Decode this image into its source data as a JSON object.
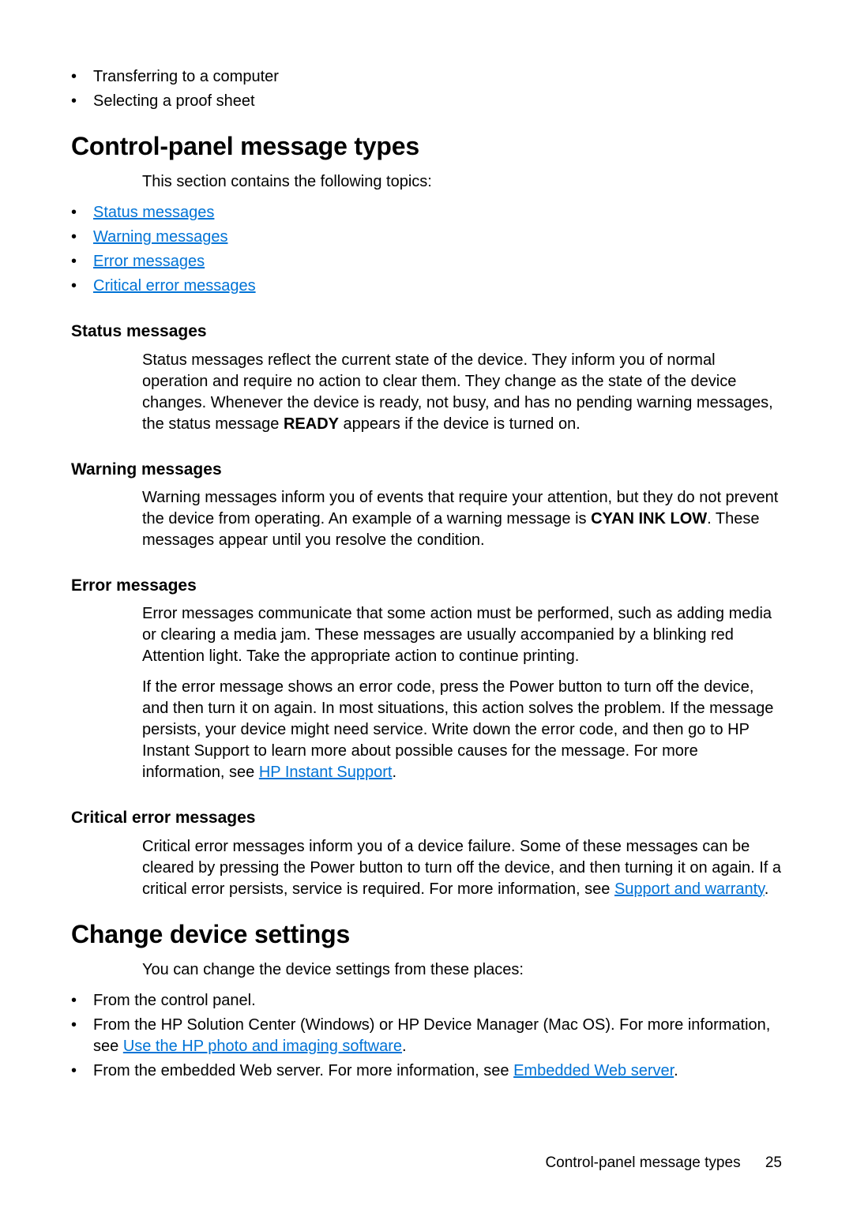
{
  "top_bullets": {
    "items": [
      "Transferring to a computer",
      "Selecting a proof sheet"
    ]
  },
  "section_cpmt": {
    "heading": "Control-panel message types",
    "intro": "This section contains the following topics:",
    "toc": [
      "Status messages",
      "Warning messages",
      "Error messages",
      "Critical error messages"
    ]
  },
  "status": {
    "heading": "Status messages",
    "p1_a": "Status messages reflect the current state of the device. They inform you of normal operation and require no action to clear them. They change as the state of the device changes. Whenever the device is ready, not busy, and has no pending warning messages, the status message ",
    "p1_b": "READY",
    "p1_c": " appears if the device is turned on."
  },
  "warning": {
    "heading": "Warning messages",
    "p1_a": "Warning messages inform you of events that require your attention, but they do not prevent the device from operating. An example of a warning message is ",
    "p1_b": "CYAN INK LOW",
    "p1_c": ". These messages appear until you resolve the condition."
  },
  "error": {
    "heading": "Error messages",
    "p1": "Error messages communicate that some action must be performed, such as adding media or clearing a media jam. These messages are usually accompanied by a blinking red Attention light. Take the appropriate action to continue printing.",
    "p2_a": "If the error message shows an error code, press the Power button to turn off the device, and then turn it on again. In most situations, this action solves the problem. If the message persists, your device might need service. Write down the error code, and then go to HP Instant Support to learn more about possible causes for the message. For more information, see ",
    "p2_link": "HP Instant Support",
    "p2_b": "."
  },
  "critical": {
    "heading": "Critical error messages",
    "p1_a": "Critical error messages inform you of a device failure. Some of these messages can be cleared by pressing the Power button to turn off the device, and then turning it on again. If a critical error persists, service is required. For more information, see ",
    "p1_link": "Support and warranty",
    "p1_b": "."
  },
  "change": {
    "heading": "Change device settings",
    "intro": "You can change the device settings from these places:",
    "items": {
      "i0": "From the control panel.",
      "i1_a": "From the HP Solution Center (Windows) or HP Device Manager (Mac OS). For more information, see ",
      "i1_link": "Use the HP photo and imaging software",
      "i1_b": ".",
      "i2_a": "From the embedded Web server. For more information, see ",
      "i2_link": "Embedded Web server",
      "i2_b": "."
    }
  },
  "footer": {
    "label": "Control-panel message types",
    "page": "25"
  }
}
